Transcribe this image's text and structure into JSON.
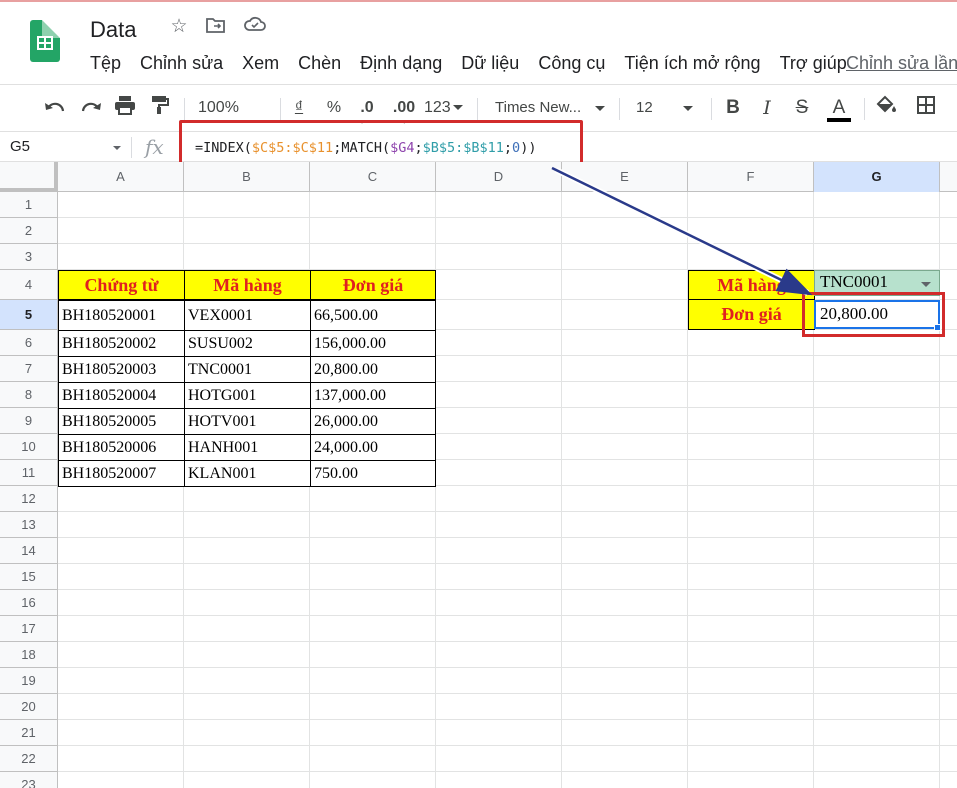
{
  "app": {
    "doc_title": "Data",
    "menu": [
      "Tệp",
      "Chỉnh sửa",
      "Xem",
      "Chèn",
      "Định dạng",
      "Dữ liệu",
      "Công cụ",
      "Tiện ích mở rộng",
      "Trợ giúp"
    ],
    "last_edit_link": "Chỉnh sửa lần c"
  },
  "toolbar": {
    "zoom": "100%",
    "currency": "₫",
    "percent": "%",
    "decrease_decimals": ".0",
    "increase_decimals": ".00",
    "more_formats": "123",
    "font_family": "Times New...",
    "font_size": "12",
    "bold": "B",
    "italic": "I",
    "strikethrough": "S",
    "text_color": "A"
  },
  "formula_bar": {
    "cell_ref": "G5",
    "fx": "fx",
    "formula_parts": [
      {
        "text": "=INDEX(",
        "color": "#202124"
      },
      {
        "text": "$C$5:$C$11",
        "color": "#e8912d"
      },
      {
        "text": ";MATCH(",
        "color": "#202124"
      },
      {
        "text": "$G4",
        "color": "#8e44ad"
      },
      {
        "text": ";",
        "color": "#202124"
      },
      {
        "text": "$B$5:$B$11",
        "color": "#2f9da8"
      },
      {
        "text": ";",
        "color": "#202124"
      },
      {
        "text": "0",
        "color": "#3d6fb8"
      },
      {
        "text": "))",
        "color": "#202124"
      }
    ]
  },
  "sheet": {
    "columns": [
      "A",
      "B",
      "C",
      "D",
      "E",
      "F",
      "G"
    ],
    "selected_column": "G",
    "rows": [
      "1",
      "2",
      "3",
      "4",
      "5",
      "6",
      "7",
      "8",
      "9",
      "10",
      "11",
      "12",
      "13",
      "14",
      "15",
      "16",
      "17",
      "18",
      "19",
      "20",
      "21",
      "22",
      "23"
    ],
    "selected_row": "5",
    "table_headers": [
      "Chứng từ",
      "Mã hàng",
      "Đơn giá"
    ],
    "table_rows": [
      [
        "BH180520001",
        "VEX0001",
        "66,500.00"
      ],
      [
        "BH180520002",
        "SUSU002",
        "156,000.00"
      ],
      [
        "BH180520003",
        "TNC0001",
        "20,800.00"
      ],
      [
        "BH180520004",
        "HOTG001",
        "137,000.00"
      ],
      [
        "BH180520005",
        "HOTV001",
        "26,000.00"
      ],
      [
        "BH180520006",
        "HANH001",
        "24,000.00"
      ],
      [
        "BH180520007",
        "KLAN001",
        "750.00"
      ]
    ],
    "lookup": {
      "label_code": "Mã hàng",
      "label_price": "Đơn giá",
      "code_value": "TNC0001",
      "price_value": "20,800.00"
    }
  },
  "colors": {
    "header_fill": "#ffff00",
    "header_text": "#e02020",
    "dropdown_fill": "#b7e1cd",
    "selection_blue": "#1a73e8",
    "highlight_red": "#d22b2b",
    "arrow_navy": "#2a3a8a"
  }
}
